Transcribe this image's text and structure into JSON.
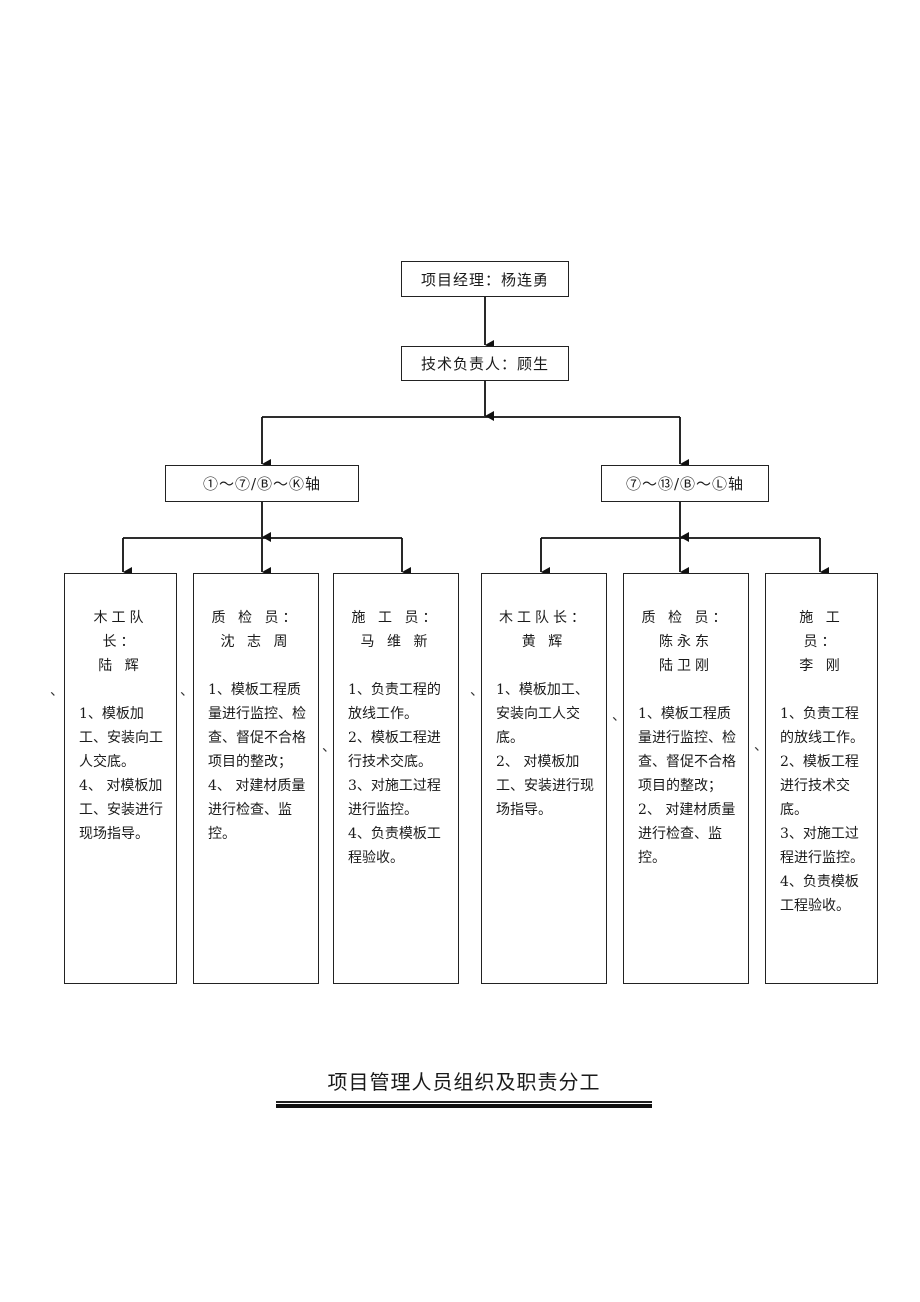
{
  "chart_title": "项目管理人员组织及职责分工",
  "manager": {
    "label": "项目经理：杨连勇"
  },
  "tech_lead": {
    "label": "技术负责人：顾生"
  },
  "branches": [
    {
      "label": "①～⑦/Ⓑ～Ⓚ轴",
      "members": [
        {
          "role": "木工队长：",
          "names": [
            "陆 辉"
          ],
          "duties": [
            "1、模板加工、安装向工人交底。",
            "4、 对模板加工、安装进行现场指导。"
          ]
        },
        {
          "role": "质 检 员：",
          "names": [
            "沈 志 周"
          ],
          "duties": [
            "1、模板工程质量进行监控、检查、督促不合格项目的整改；",
            "4、 对建材质量进行检查、监控。"
          ]
        },
        {
          "role": "施 工 员：",
          "names": [
            "马 维 新"
          ],
          "duties": [
            "1、负责工程的放线工作。",
            "2、模板工程进行技术交底。",
            "3、对施工过程进行监控。",
            "4、负责模板工程验收。"
          ]
        }
      ]
    },
    {
      "label": "⑦～⑬/Ⓑ～Ⓛ轴",
      "members": [
        {
          "role": "木工队长：",
          "names": [
            "黄 辉"
          ],
          "duties": [
            "1、模板加工、安装向工人交底。",
            "2、 对模板加工、安装进行现场指导。"
          ]
        },
        {
          "role": "质 检 员：",
          "names": [
            "陈永东",
            "陆卫刚"
          ],
          "duties": [
            "1、模板工程质量进行监控、检查、督促不合格项目的整改；",
            "2、 对建材质量进行检查、监控。"
          ]
        },
        {
          "role": "施 工 员：",
          "names": [
            "李 刚"
          ],
          "duties": [
            "1、负责工程的放线工作。",
            "2、模板工程进行技术交底。",
            "3、对施工过程进行监控。",
            "4、负责模板工程验收。"
          ]
        }
      ]
    }
  ],
  "stray_mark": "、"
}
